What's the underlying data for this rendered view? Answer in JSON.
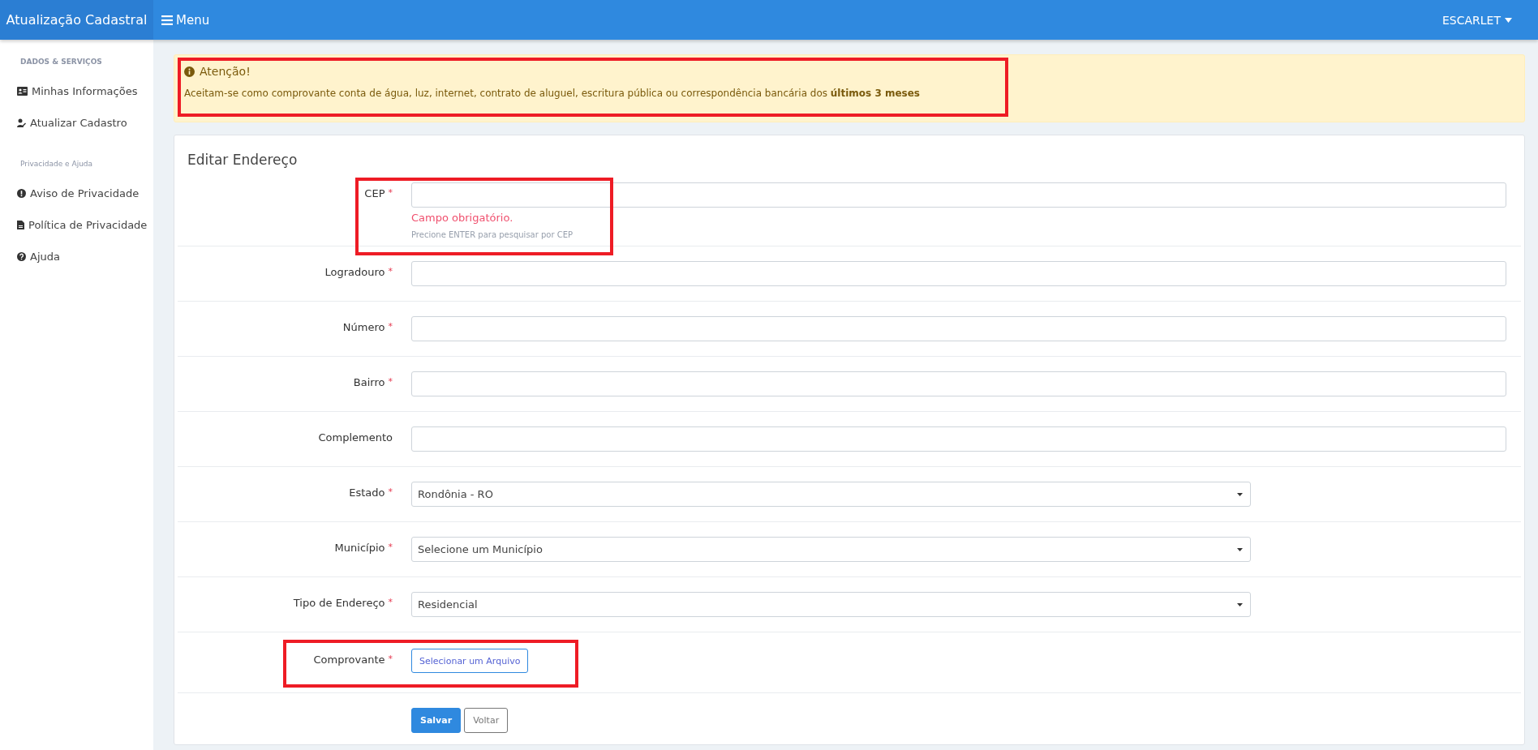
{
  "navbar": {
    "brand": "Atualização Cadastral",
    "menu_label": "Menu",
    "user": "ESCARLET"
  },
  "sidebar": {
    "sections": [
      {
        "heading": "DADOS & SERVIÇOS",
        "items": [
          {
            "label": "Minhas Informações"
          },
          {
            "label": "Atualizar Cadastro"
          }
        ]
      },
      {
        "heading": "Privacidade e Ajuda",
        "items": [
          {
            "label": "Aviso de Privacidade"
          },
          {
            "label": "Política de Privacidade"
          },
          {
            "label": "Ajuda"
          }
        ]
      }
    ]
  },
  "alert": {
    "title": "Atenção!",
    "text": "Aceitam-se como comprovante conta de água, luz, internet, contrato de aluguel, escritura pública ou correspondência bancária dos **últimos 3 meses**",
    "highlighted": true
  },
  "form": {
    "title": "Editar Endereço",
    "fields": [
      {
        "kind": "text",
        "label": "CEP",
        "marker": "*",
        "error": "Campo obrigatório.",
        "hint": "Precione ENTER para pesquisar por CEP",
        "highlighted": true
      },
      {
        "kind": "text",
        "label": "Logradouro",
        "marker": "*",
        "highlighted": false
      },
      {
        "kind": "text",
        "label": "Número",
        "marker": "*",
        "highlighted": false
      },
      {
        "kind": "text",
        "label": "Bairro",
        "marker": "*",
        "highlighted": false
      },
      {
        "kind": "text",
        "label": "Complemento",
        "highlighted": false
      },
      {
        "kind": "select",
        "label": "Estado",
        "marker": "*",
        "value": "Rondônia - RO",
        "highlighted": false
      },
      {
        "kind": "select",
        "label": "Município",
        "marker": "*",
        "value": "Selecione um Município",
        "highlighted": false
      },
      {
        "kind": "select",
        "label": "Tipo de Endereço",
        "marker": "*",
        "value": "Residencial",
        "highlighted": false
      },
      {
        "kind": "file",
        "label": "Comprovante",
        "marker": "*",
        "button": "Selecionar um Arquivo",
        "highlighted": true
      }
    ],
    "buttons": [
      {
        "kind": "primary",
        "label": "Salvar"
      },
      {
        "kind": "secondary",
        "label": "Voltar"
      }
    ]
  }
}
